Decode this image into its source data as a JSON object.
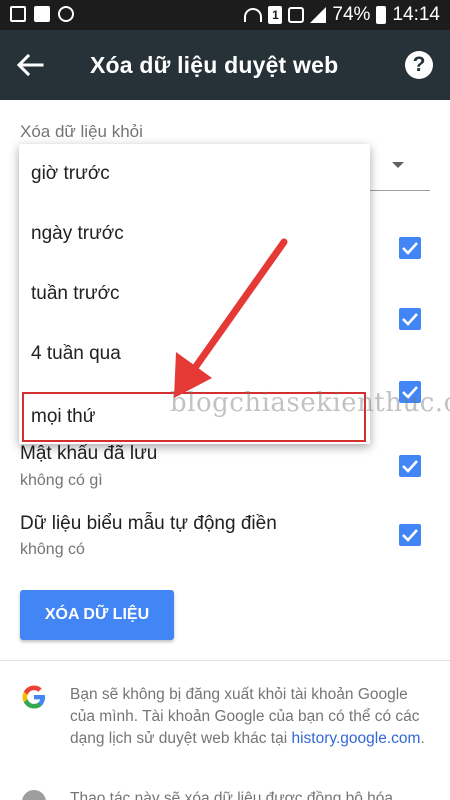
{
  "status_bar": {
    "battery_percent": "74%",
    "time": "14:14",
    "sim_number": "1"
  },
  "app_bar": {
    "title": "Xóa dữ liệu duyệt web"
  },
  "time_range": {
    "label": "Xóa dữ liệu khỏi",
    "options": [
      {
        "label": "giờ trước"
      },
      {
        "label": "ngày trước"
      },
      {
        "label": "tuần trước"
      },
      {
        "label": "4 tuần qua"
      },
      {
        "label": "mọi thứ"
      }
    ],
    "highlighted_option": "mọi thứ"
  },
  "data_rows": [
    {
      "title": "Mật khẩu đã lưu",
      "subtitle": "không có gì",
      "checked": true
    },
    {
      "title": "Dữ liệu biểu mẫu tự động điền",
      "subtitle": "không có",
      "checked": true
    }
  ],
  "hidden_checked_rows": 3,
  "clear_button": {
    "label": "XÓA DỮ LIỆU"
  },
  "info": {
    "text": "Bạn sẽ không bị đăng xuất khỏi tài khoản Google của mình. Tài khoản Google của bạn có thể có các dạng lịch sử duyệt web khác tại ",
    "link": "history.google.com",
    "link_suffix": ".",
    "text_2": "Thao tác này sẽ xóa dữ liệu được đồng bộ hóa"
  },
  "watermark": "blogchiasekienthuc.com",
  "colors": {
    "app_bar": "#263238",
    "accent": "#4285f4",
    "highlight_border": "#d32f2f",
    "arrow": "#e53935"
  }
}
